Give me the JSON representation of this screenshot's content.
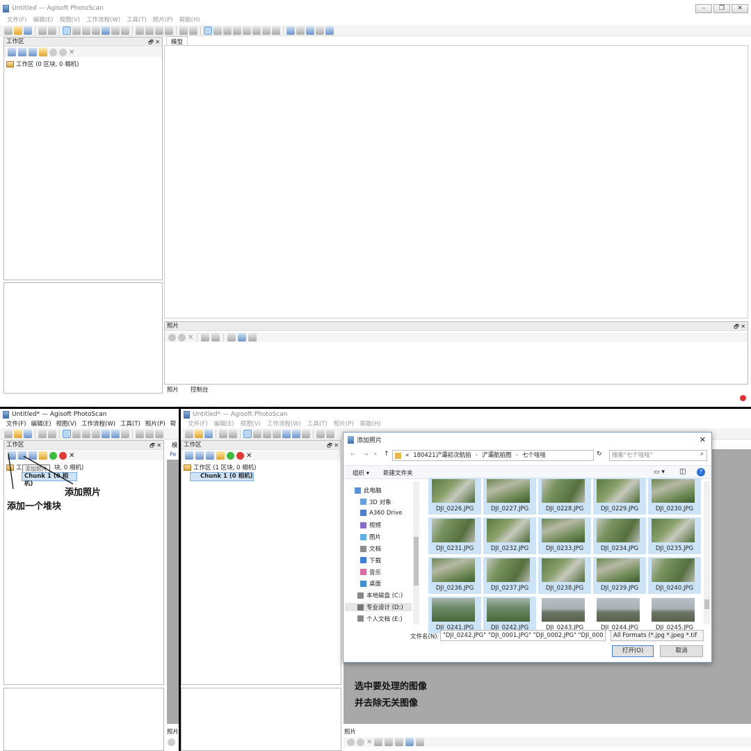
{
  "top": {
    "title": "Untitled — Agisoft PhotoScan",
    "menu": [
      "文件(F)",
      "编辑(E)",
      "视图(V)",
      "工作流程(W)",
      "工具(T)",
      "照片(P)",
      "帮助(H)"
    ],
    "workspace_header": "工作区",
    "workspace_root": "工作区 (0 区块, 0 相机)",
    "model_tab": "模型",
    "photos_header": "照片",
    "bottom_tabs": [
      "照片",
      "控制台"
    ]
  },
  "left": {
    "title": "Untitled* — Agisoft PhotoScan",
    "menu": [
      "文件(F)",
      "编辑(E)",
      "视图(V)",
      "工作流程(W)",
      "工具(T)",
      "照片(P)",
      "帮"
    ],
    "workspace_header": "工作区",
    "workspace_root": "工作区 (1 区块, 0 相机)",
    "workspace_root_visible": "工",
    "workspace_root_tail": "块, 0 相机)",
    "chunk": "Chunk 1 (0 相机)",
    "tooltip": "添加照片",
    "annot_add_photos": "添加照片",
    "annot_add_chunk": "添加一个堆块",
    "side_tab": "模",
    "side_small": "Pe",
    "photos_header": "照片"
  },
  "right": {
    "title": "Untitled* — Agisoft PhotoScan",
    "menu": [
      "文件(F)",
      "编辑(E)",
      "视图(V)",
      "工作流程(W)",
      "工具(T)",
      "照片(P)",
      "帮助(H)"
    ],
    "workspace_header": "工作区",
    "workspace_root": "工作区 (1 区块, 0 相机)",
    "chunk": "Chunk 1 (0 相机)",
    "annot_line1": "选中要处理的图像",
    "annot_line2": "并去除无关图像",
    "photos_header": "照片"
  },
  "dialog": {
    "title": "添加照片",
    "breadcrumb": [
      "«",
      "180421浐灞初次航拍",
      "浐灞航拍图",
      "七个哇哇"
    ],
    "search_placeholder": "搜索\"七个哇哇\"",
    "organize": "组织 ▾",
    "new_folder": "新建文件夹",
    "nav": [
      "此电脑",
      "3D 对象",
      "A360 Drive",
      "视频",
      "图片",
      "文档",
      "下载",
      "音乐",
      "桌面",
      "本地磁盘 (C:)",
      "专业设计 (D:)",
      "个人文档 (E:)"
    ],
    "files": [
      "DJI_0226.JPG",
      "DJI_0227.JPG",
      "DJI_0228.JPG",
      "DJI_0229.JPG",
      "DJI_0230.JPG",
      "DJI_0231.JPG",
      "DJI_0232.JPG",
      "DJI_0233.JPG",
      "DJI_0234.JPG",
      "DJI_0235.JPG",
      "DJI_0236.JPG",
      "DJI_0237.JPG",
      "DJI_0238.JPG",
      "DJI_0239.JPG",
      "DJI_0240.JPG",
      "DJI_0241.JPG",
      "DJI_0242.JPG",
      "DJI_0243.JPG",
      "DJI_0244.JPG",
      "DJI_0245.JPG"
    ],
    "selected_count": 17,
    "filename_label": "文件名(N):",
    "filename_value": "\"DJI_0242.JPG\" \"DJI_0001.JPG\" \"DJI_0002.JPG\" \"DJI_000",
    "filetype": "All Formats (*.jpg *.jpeg *.tif",
    "open": "打开(O)",
    "cancel": "取消",
    "close": "✕"
  },
  "colors": {
    "selection": "#cde4f7",
    "accent": "#3c7fd6",
    "dark_area": "#a8a8a8"
  }
}
